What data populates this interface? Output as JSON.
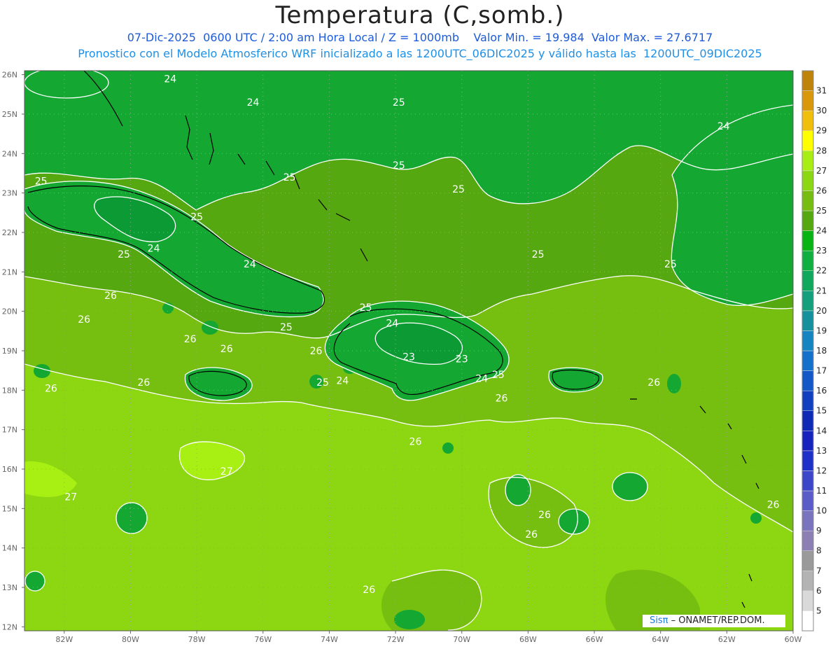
{
  "title": "Temperatura (C,somb.)",
  "subtitle1": "07-Dic-2025  0600 UTC / 2:00 am Hora Local / Z = 1000mb    Valor Min. = 19.984  Valor Max. = 27.6717",
  "subtitle2": "Pronostico con el Modelo Atmosferico WRF inicializado a las 1200UTC_06DIC2025 y válido hasta las  1200UTC_09DIC2025",
  "credit": {
    "brand": "Sisπ",
    "text": " – ONAMET/REP.DOM."
  },
  "map": {
    "lat_labels": [
      "26N",
      "25N",
      "24N",
      "23N",
      "22N",
      "21N",
      "20N",
      "19N",
      "18N",
      "17N",
      "16N",
      "15N",
      "14N",
      "13N",
      "12N"
    ],
    "lon_labels": [
      "82W",
      "80W",
      "78W",
      "76W",
      "74W",
      "72W",
      "70W",
      "68W",
      "66W",
      "64W",
      "62W",
      "60W"
    ],
    "contour_labels": [
      {
        "text": "24",
        "lon": -78.8,
        "lat": 25.9
      },
      {
        "text": "24",
        "lon": -76.3,
        "lat": 25.3
      },
      {
        "text": "25",
        "lon": -71.9,
        "lat": 25.3
      },
      {
        "text": "24",
        "lon": -62.1,
        "lat": 24.7
      },
      {
        "text": "25",
        "lon": -71.9,
        "lat": 23.7
      },
      {
        "text": "25",
        "lon": -75.2,
        "lat": 23.4
      },
      {
        "text": "25",
        "lon": -82.7,
        "lat": 23.3
      },
      {
        "text": "25",
        "lon": -70.1,
        "lat": 23.1
      },
      {
        "text": "25",
        "lon": -78.0,
        "lat": 22.4
      },
      {
        "text": "24",
        "lon": -79.3,
        "lat": 21.6
      },
      {
        "text": "25",
        "lon": -80.2,
        "lat": 21.45
      },
      {
        "text": "25",
        "lon": -67.7,
        "lat": 21.45
      },
      {
        "text": "24",
        "lon": -76.4,
        "lat": 21.2
      },
      {
        "text": "25",
        "lon": -63.7,
        "lat": 21.2
      },
      {
        "text": "26",
        "lon": -80.6,
        "lat": 20.4
      },
      {
        "text": "25",
        "lon": -72.9,
        "lat": 20.1
      },
      {
        "text": "26",
        "lon": -81.4,
        "lat": 19.8
      },
      {
        "text": "24",
        "lon": -72.1,
        "lat": 19.7
      },
      {
        "text": "25",
        "lon": -75.3,
        "lat": 19.6
      },
      {
        "text": "26",
        "lon": -78.2,
        "lat": 19.3
      },
      {
        "text": "26",
        "lon": -77.1,
        "lat": 19.05
      },
      {
        "text": "26",
        "lon": -74.4,
        "lat": 19.0
      },
      {
        "text": "23",
        "lon": -71.6,
        "lat": 18.85
      },
      {
        "text": "23",
        "lon": -70.0,
        "lat": 18.8
      },
      {
        "text": "26",
        "lon": -79.6,
        "lat": 18.2
      },
      {
        "text": "25",
        "lon": -74.2,
        "lat": 18.2
      },
      {
        "text": "24",
        "lon": -73.6,
        "lat": 18.25
      },
      {
        "text": "24",
        "lon": -69.4,
        "lat": 18.3
      },
      {
        "text": "25",
        "lon": -68.9,
        "lat": 18.4
      },
      {
        "text": "26",
        "lon": -64.2,
        "lat": 18.2
      },
      {
        "text": "26",
        "lon": -82.4,
        "lat": 18.05
      },
      {
        "text": "26",
        "lon": -68.8,
        "lat": 17.8
      },
      {
        "text": "26",
        "lon": -71.4,
        "lat": 16.7
      },
      {
        "text": "27",
        "lon": -77.1,
        "lat": 15.95
      },
      {
        "text": "27",
        "lon": -81.8,
        "lat": 15.3
      },
      {
        "text": "26",
        "lon": -60.6,
        "lat": 15.1
      },
      {
        "text": "26",
        "lon": -67.5,
        "lat": 14.85
      },
      {
        "text": "26",
        "lon": -67.9,
        "lat": 14.35
      },
      {
        "text": "26",
        "lon": -72.8,
        "lat": 12.95
      }
    ],
    "colorbar": {
      "levels": [
        "5",
        "6",
        "7",
        "8",
        "9",
        "10",
        "11",
        "12",
        "13",
        "14",
        "15",
        "16",
        "17",
        "18",
        "19",
        "20",
        "21",
        "22",
        "23",
        "24",
        "25",
        "26",
        "27",
        "28",
        "29",
        "30",
        "31"
      ],
      "colors": [
        "#ffffff",
        "#d9d9d9",
        "#b3b3b3",
        "#9a9a9a",
        "#8b7fb3",
        "#7a73bd",
        "#5c5cc8",
        "#3c46c8",
        "#1f30c8",
        "#1822bd",
        "#0f2ab5",
        "#1040c0",
        "#1458c8",
        "#1470c8",
        "#1684c0",
        "#16909a",
        "#14a07c",
        "#10a85c",
        "#0fb040",
        "#08b414",
        "#55a80f",
        "#77bc10",
        "#8cd612",
        "#a8ee14",
        "#ffff00",
        "#f2be0c",
        "#d8980a",
        "#bf820a"
      ]
    },
    "fill_colors": {
      "t23": "#0b9a34",
      "t24": "#14a832",
      "t25": "#55a80f",
      "t26": "#76bf10",
      "t27": "#8cd612",
      "t28": "#a8f014",
      "land": "#000000",
      "contour": "#ffffff"
    }
  }
}
